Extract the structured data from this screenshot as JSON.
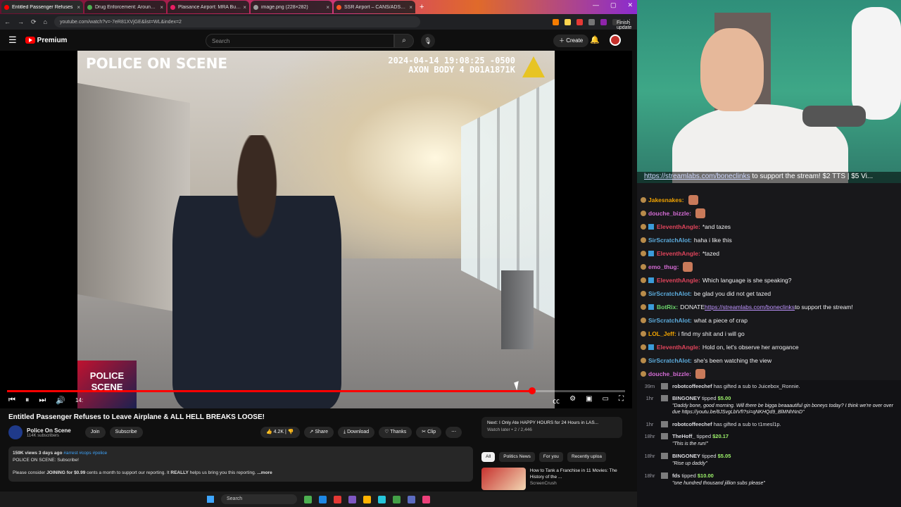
{
  "browser": {
    "tabs": [
      {
        "label": "Entitled Passenger Refuses",
        "color": "#ff0000",
        "active": true
      },
      {
        "label": "Drug Enforcement: Around R...",
        "color": "#4caf50",
        "active": false
      },
      {
        "label": "Plaisance Airport: MRA Busted",
        "color": "#e91e63",
        "active": false
      },
      {
        "label": "image.png (228×282)",
        "color": "#9e9e9e",
        "active": false
      },
      {
        "label": "SSR Airport – CANS/ADSU Op...",
        "color": "#ff5722",
        "active": false
      }
    ],
    "url": "youtube.com/watch?v=-7eR81XVjGE&list=WL&index=2",
    "finish_update": "Finish update"
  },
  "youtube": {
    "brand": "Premium",
    "search_placeholder": "Search",
    "create_label": "Create",
    "video": {
      "overlay_left": "POLICE ON SCENE",
      "overlay_right_line1": "2024-04-14 19:08:25 -0500",
      "overlay_right_line2": "AXON BODY 4 D01A1871K",
      "badge_line1": "POLICE",
      "badge_line2": "SCENE",
      "progress": 0.85,
      "time": "14:"
    },
    "title": "Entitled Passenger Refuses to Leave Airplane & ALL HELL BREAKS LOOSE!",
    "channel": {
      "name": "Police On Scene",
      "subs": "114K subscribers"
    },
    "join_label": "Join",
    "subscribe_label": "Subscribe",
    "like_count": "4.2K",
    "share_label": "Share",
    "download_label": "Download",
    "thanks_label": "Thanks",
    "clip_label": "Clip",
    "description": {
      "meta": "159K views  3 days ago",
      "tags": "#arrest #cops #police",
      "line2": "POLICE ON SCENE: Subscribe!",
      "line3_a": "Please consider",
      "line3_join": "JOINING for $0.99",
      "line3_b": "cents a month to support our reporting. It",
      "line3_really": "REALLY",
      "line3_c": "helps us bring you this reporting.",
      "more": "...more"
    },
    "up_next": {
      "title": "Next: I Only Ate HAPPY HOURS for 24 Hours in LAS...",
      "sub": "Watch later • 2 / 2,446"
    },
    "chips": [
      "All",
      "Politics News",
      "For you",
      "Recently uploa"
    ],
    "rec": {
      "title": "How to Tank a Franchise in 11 Movies: The History of the ...",
      "channel": "ScreenCrush"
    }
  },
  "taskbar": {
    "search": "Search"
  },
  "cam": {
    "link_url": "https://streamlabs.com/boneclinks",
    "link_rest": " to support the stream! $2 TTS | $5 Vi..."
  },
  "chat": [
    {
      "name": "Jakesnakes:",
      "color": "n-orange",
      "text": "",
      "emote": true,
      "sub": false
    },
    {
      "name": "douche_bizzle:",
      "color": "n-pink",
      "text": "",
      "emote": true,
      "sub": false
    },
    {
      "name": "EleventhAngle:",
      "color": "n-red",
      "text": "*and tazes",
      "emote": false,
      "sub": true
    },
    {
      "name": "SirScratchAlot:",
      "color": "n-blue",
      "text": "haha i like this",
      "emote": false,
      "sub": false
    },
    {
      "name": "EleventhAngle:",
      "color": "n-red",
      "text": "*tazed",
      "emote": false,
      "sub": true
    },
    {
      "name": "emo_thug:",
      "color": "n-pink",
      "text": "",
      "emote": true,
      "sub": false
    },
    {
      "name": "EleventhAngle:",
      "color": "n-red",
      "text": "Which language is she speaking?",
      "emote": false,
      "sub": true
    },
    {
      "name": "SirScratchAlot:",
      "color": "n-blue",
      "text": "be glad you did not get tazed",
      "emote": false,
      "sub": false
    },
    {
      "name": "BotRix:",
      "color": "n-green",
      "text": "DONATE ",
      "link": "https://streamlabs.com/boneclinks",
      "after": " to support the stream!",
      "emote": false,
      "sub": true
    },
    {
      "name": "SirScratchAlot:",
      "color": "n-blue",
      "text": "what a piece of crap",
      "emote": false,
      "sub": false
    },
    {
      "name": "LOL_Jeff:",
      "color": "n-orange",
      "text": "i find my shit and i will go",
      "emote": false,
      "sub": false
    },
    {
      "name": "EleventhAngle:",
      "color": "n-red",
      "text": "Hold on, let's observe her arrogance",
      "emote": false,
      "sub": true
    },
    {
      "name": "SirScratchAlot:",
      "color": "n-blue",
      "text": "she's been watching the view",
      "emote": false,
      "sub": false
    },
    {
      "name": "douche_bizzle:",
      "color": "n-pink",
      "text": "",
      "emote": true,
      "sub": false
    }
  ],
  "events": [
    {
      "time": "39m",
      "who": "robotcoffeechef",
      "text": " has gifted a sub to Juicebox_Ronnie.",
      "amount": "",
      "quote": ""
    },
    {
      "time": "1hr",
      "who": "BINGONEY",
      "text": " tipped ",
      "amount": "$5.00",
      "quote": "\"Daddy bone, good morning. Will there be bigga beaaautiful gin boneys today? I think we're over over due https://youtu.be/8JSvgLbIVfI?si=qNKHQd9_BlMNhNnD\""
    },
    {
      "time": "1hr",
      "who": "robotcoffeechef",
      "text": " has gifted a sub to t1mesl1p.",
      "amount": "",
      "quote": ""
    },
    {
      "time": "18hr",
      "who": "TheHoff_",
      "text": " tipped ",
      "amount": "$20.17",
      "quote": "\"This is the run!\""
    },
    {
      "time": "18hr",
      "who": "BINGONEY",
      "text": " tipped ",
      "amount": "$5.05",
      "quote": "\"Rise up daddy\""
    },
    {
      "time": "18hr",
      "who": "fds",
      "text": " tipped ",
      "amount": "$10.00",
      "quote": "\"one hundred thousand jillion subs please\""
    }
  ]
}
